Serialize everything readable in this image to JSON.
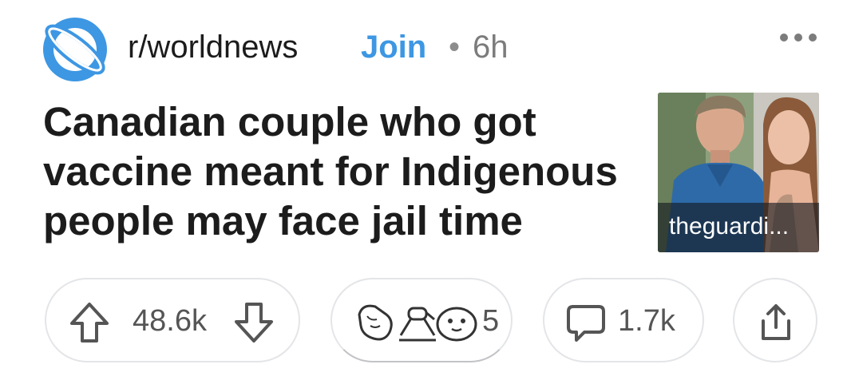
{
  "header": {
    "subreddit": "r/worldnews",
    "join_label": "Join",
    "separator": "•",
    "age": "6h",
    "subreddit_icon": "globe-icon",
    "more_icon": "more-horizontal-icon"
  },
  "post": {
    "title": "Canadian couple who got vaccine meant for Indigenous people may face jail time",
    "thumbnail_caption": "theguardi..."
  },
  "actions": {
    "score": "48.6k",
    "upvote_icon": "upvote-arrow-icon",
    "downvote_icon": "downvote-arrow-icon",
    "award_count": "5",
    "award_icons": [
      "hand-award-icon",
      "arm-wrestle-award-icon",
      "seal-award-icon"
    ],
    "comments": "1.7k",
    "comment_icon": "comment-bubble-icon",
    "share_icon": "share-icon"
  },
  "colors": {
    "accent_blue": "#3d97e3",
    "text_dark": "#1c1c1c",
    "text_muted": "#7c7c7c",
    "pill_border": "#e4e5e8"
  }
}
